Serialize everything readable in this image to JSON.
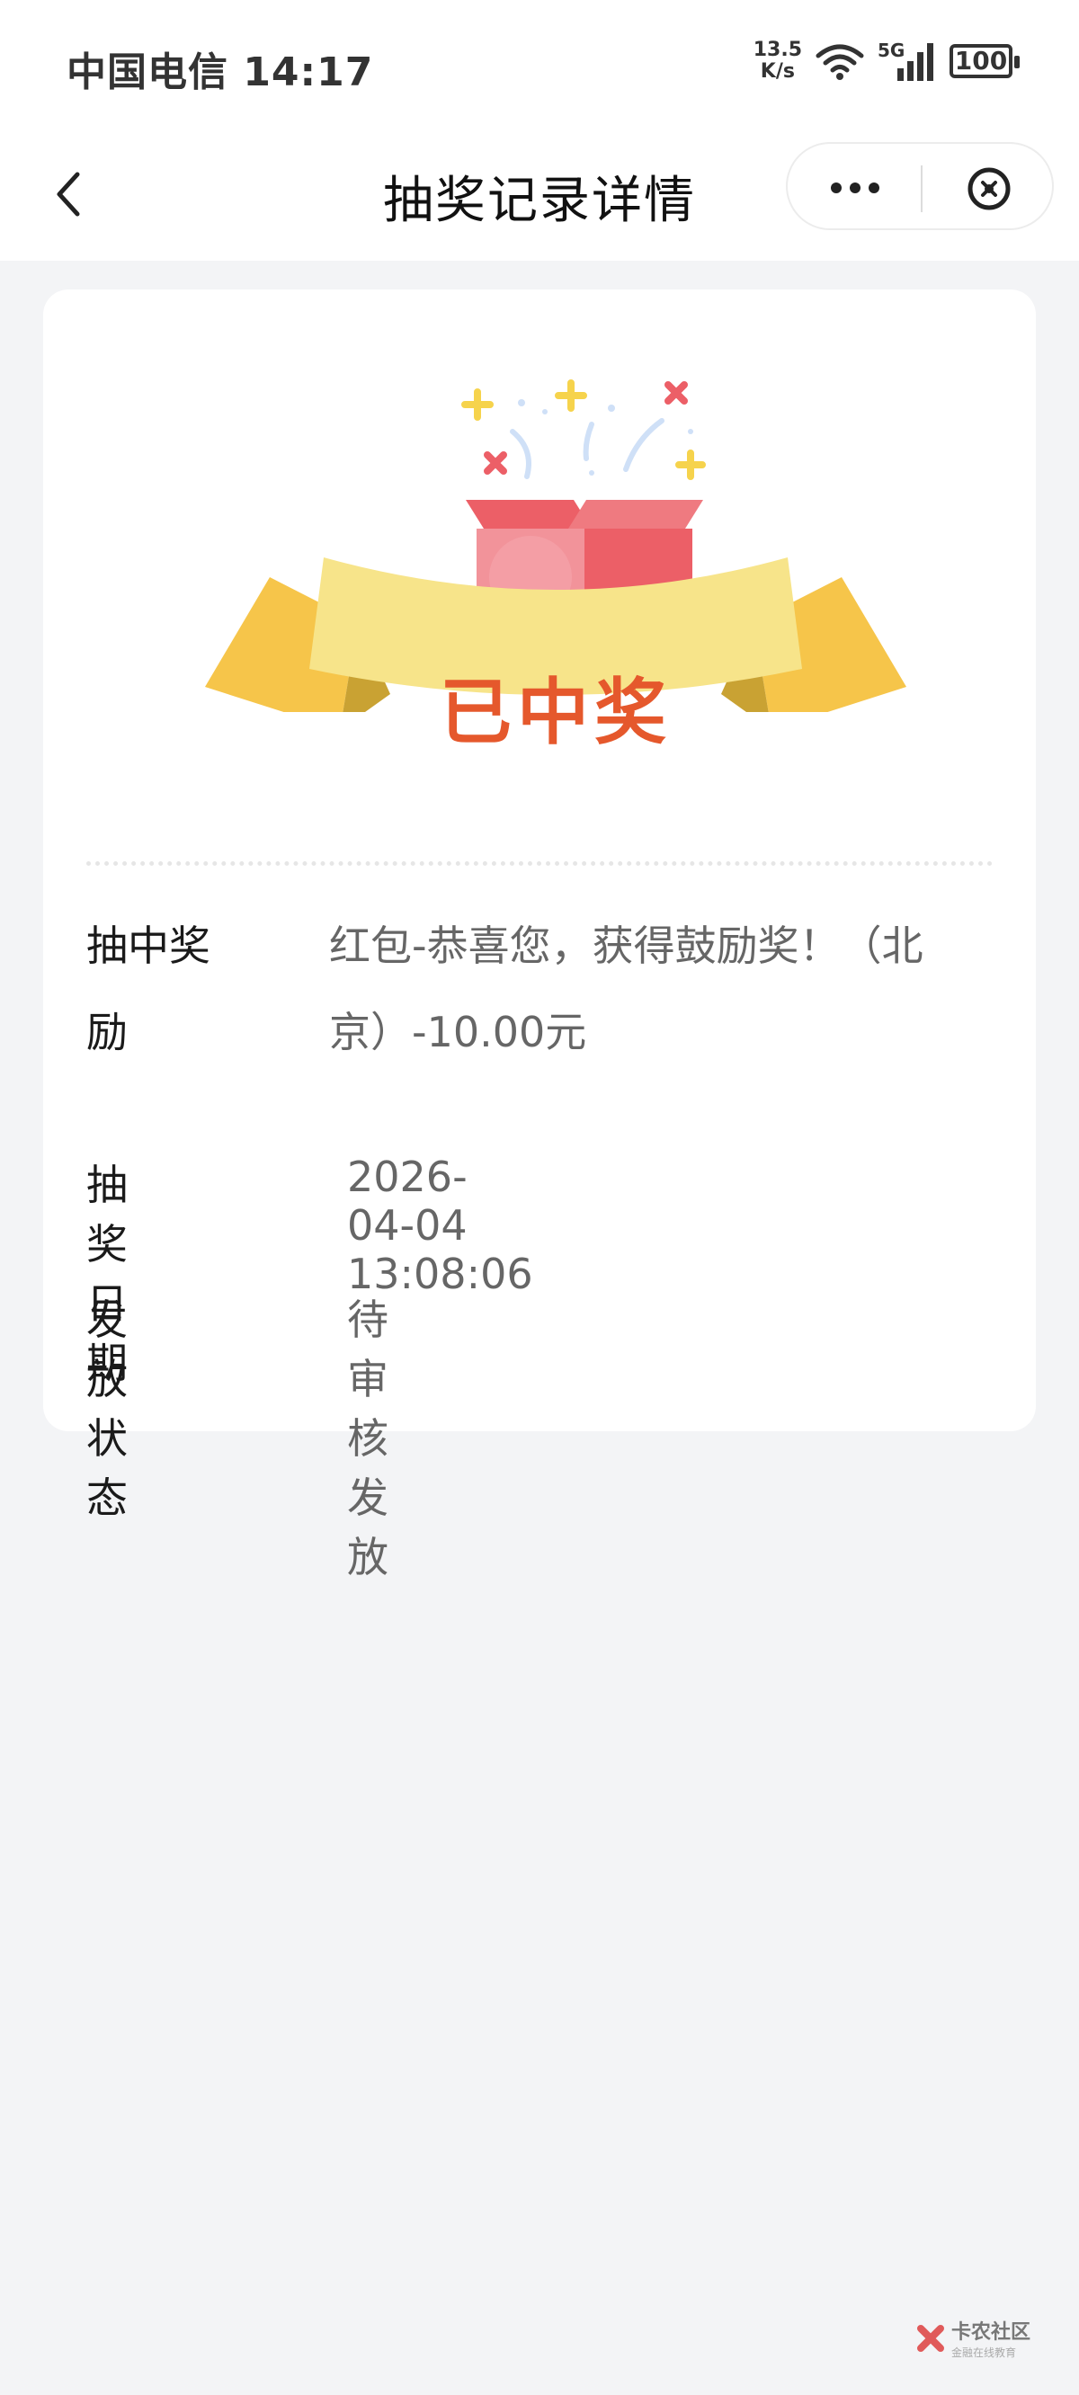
{
  "status_bar": {
    "carrier_time": "中国电信 14:17",
    "net_speed_value": "13.5",
    "net_speed_unit": "K/s",
    "network_type": "5G",
    "battery": "100"
  },
  "nav": {
    "title": "抽奖记录详情"
  },
  "hero": {
    "label": "已中奖"
  },
  "details": {
    "prize_label": "抽中奖励",
    "prize_value": "红包-恭喜您，获得鼓励奖！（北京）-10.00元",
    "date_label": "抽奖日期",
    "date_value": "2026-04-04 13:08:06",
    "status_label": "发放状态",
    "status_value": "待审核发放"
  },
  "watermark": {
    "name": "卡农社区",
    "tagline": "金融在线教育"
  },
  "colors": {
    "accent_orange": "#e5582c",
    "ribbon_yellow": "#f7e48a",
    "box_red": "#ec5f67",
    "background": "#f3f4f6"
  }
}
